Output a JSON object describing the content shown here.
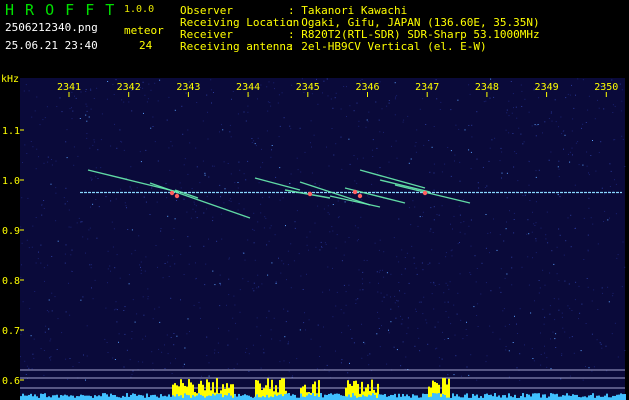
{
  "app": {
    "name": "H R O F F T",
    "version": "1.0.0"
  },
  "file": {
    "name": "2506212340.png",
    "datetime": "25.06.21 23:40"
  },
  "meteor": {
    "label": "meteor",
    "count": "24"
  },
  "info": [
    {
      "label": "Observer",
      "value": ": Takanori Kawachi"
    },
    {
      "label": "Receiving Location",
      "value": ": Ogaki, Gifu, JAPAN (136.60E, 35.35N)"
    },
    {
      "label": "Receiver",
      "value": ": R820T2(RTL-SDR) SDR-Sharp 53.1000MHz"
    },
    {
      "label": "Receiving antenna",
      "value": ": 2el-HB9CV Vertical (el. E-W)"
    }
  ],
  "spectrogram": {
    "y_unit": "kHz",
    "y_ticks": [
      "1.1",
      "1.0",
      "0.9",
      "0.8",
      "0.7",
      "0.6"
    ],
    "x_ticks": [
      "2341",
      "2342",
      "2343",
      "2344",
      "2345",
      "2346",
      "2347",
      "2348",
      "2349",
      "2350"
    ],
    "carrier_khz": 0.975,
    "colors": {
      "background": "#0a0a3a",
      "carrier": "#8ad8ff",
      "trail": "#6af0b0",
      "head": "#ff6060",
      "bars": "#ffff00",
      "noise_floor": "#40c0ff"
    }
  }
}
